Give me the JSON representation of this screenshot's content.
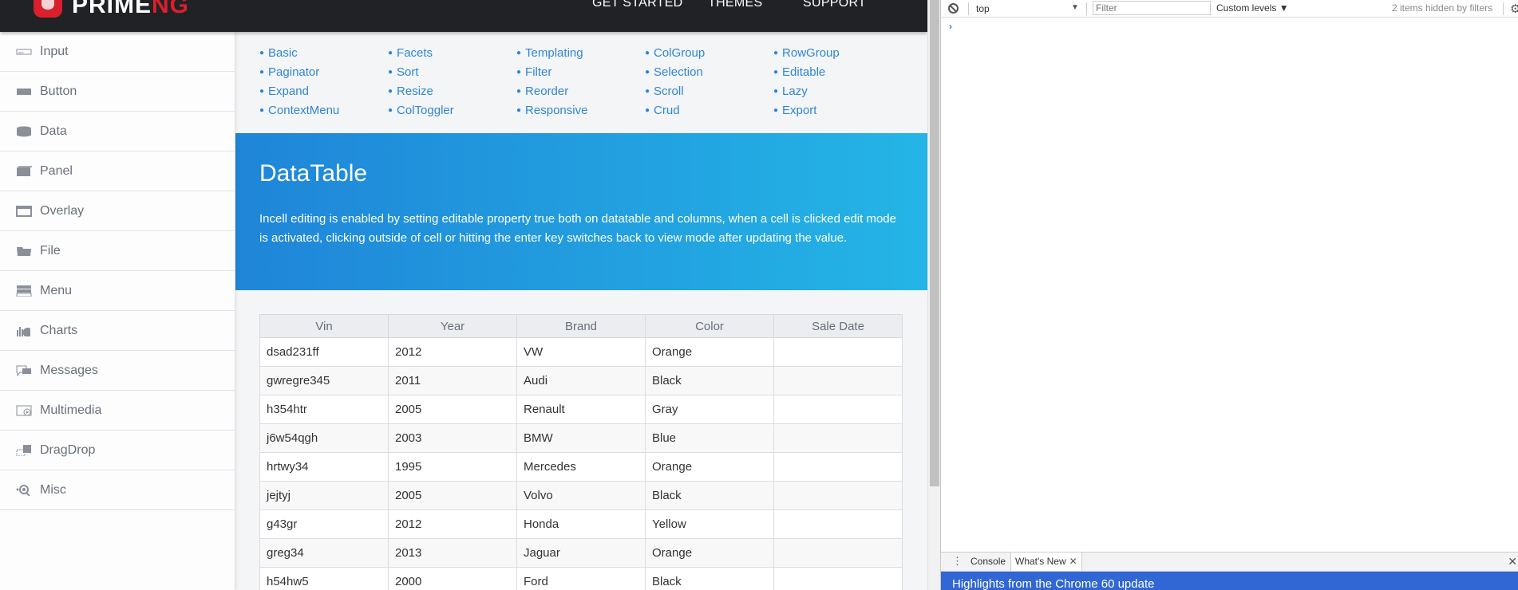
{
  "topbar": {
    "logo_text_prime": "PRIME",
    "logo_text_ng": "NG",
    "nav": [
      "GET STARTED",
      "THEMES",
      "SUPPORT"
    ]
  },
  "sidebar": {
    "items": [
      {
        "label": "Input",
        "icon": "input-icon"
      },
      {
        "label": "Button",
        "icon": "button-icon"
      },
      {
        "label": "Data",
        "icon": "database-icon"
      },
      {
        "label": "Panel",
        "icon": "panel-icon"
      },
      {
        "label": "Overlay",
        "icon": "overlay-icon"
      },
      {
        "label": "File",
        "icon": "folder-icon"
      },
      {
        "label": "Menu",
        "icon": "menu-icon"
      },
      {
        "label": "Charts",
        "icon": "charts-icon"
      },
      {
        "label": "Messages",
        "icon": "messages-icon"
      },
      {
        "label": "Multimedia",
        "icon": "multimedia-icon"
      },
      {
        "label": "DragDrop",
        "icon": "dragdrop-icon"
      },
      {
        "label": "Misc",
        "icon": "misc-icon"
      }
    ]
  },
  "sublinks": [
    "Basic",
    "Facets",
    "Templating",
    "ColGroup",
    "RowGroup",
    "Paginator",
    "Sort",
    "Filter",
    "Selection",
    "Editable",
    "Expand",
    "Resize",
    "Reorder",
    "Scroll",
    "Lazy",
    "ContextMenu",
    "ColToggler",
    "Responsive",
    "Crud",
    "Export"
  ],
  "banner": {
    "title": "DataTable",
    "description": "Incell editing is enabled by setting editable property true both on datatable and columns, when a cell is clicked edit mode is activated, clicking outside of cell or hitting the enter key switches back to view mode after updating the value."
  },
  "table": {
    "columns": [
      "Vin",
      "Year",
      "Brand",
      "Color",
      "Sale Date"
    ],
    "rows": [
      [
        "dsad231ff",
        "2012",
        "VW",
        "Orange",
        ""
      ],
      [
        "gwregre345",
        "2011",
        "Audi",
        "Black",
        ""
      ],
      [
        "h354htr",
        "2005",
        "Renault",
        "Gray",
        ""
      ],
      [
        "j6w54qgh",
        "2003",
        "BMW",
        "Blue",
        ""
      ],
      [
        "hrtwy34",
        "1995",
        "Mercedes",
        "Orange",
        ""
      ],
      [
        "jejtyj",
        "2005",
        "Volvo",
        "Black",
        ""
      ],
      [
        "g43gr",
        "2012",
        "Honda",
        "Yellow",
        ""
      ],
      [
        "greg34",
        "2013",
        "Jaguar",
        "Orange",
        ""
      ],
      [
        "h54hw5",
        "2000",
        "Ford",
        "Black",
        ""
      ]
    ]
  },
  "devtools": {
    "context": "top",
    "filter_placeholder": "Filter",
    "levels": "Custom levels ▼",
    "hidden_count": "2 items hidden by filters",
    "prompt": "›",
    "drawer_tabs": [
      "Console",
      "What's New"
    ],
    "whats_new_title": "Highlights from the Chrome 60 update"
  },
  "colors": {
    "topbar": "#212226",
    "brand_red": "#d9202c",
    "link_blue": "#2f86d8",
    "banner_start": "#1f85d8",
    "banner_end": "#24b5e6",
    "devtools_blue": "#3067d4"
  }
}
